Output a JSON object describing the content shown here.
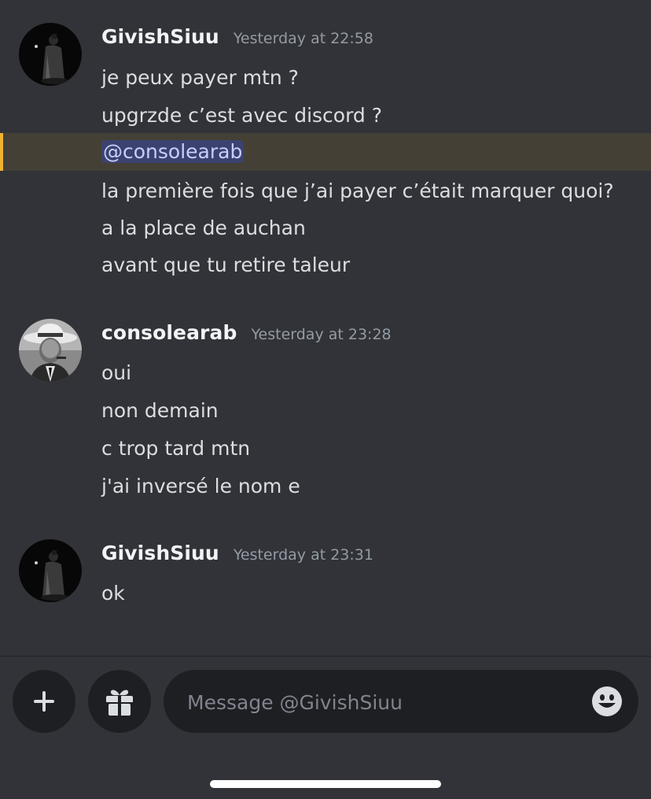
{
  "conversation": {
    "groups": [
      {
        "username": "GivishSiuu",
        "timestamp": "Yesterday at 22:58",
        "avatar": "dark-night-figure-avatar",
        "lines": [
          "je peux payer mtn ?",
          "upgrzde c’est avec discord ?",
          "@consolearab",
          "la première fois que j’ai payer c’était marquer quoi?",
          "a la place de auchan",
          "avant que tu retire taleur"
        ]
      },
      {
        "username": "consolearab",
        "timestamp": "Yesterday at 23:28",
        "avatar": "man-in-fedora-avatar",
        "lines": [
          "oui",
          "non demain",
          "c trop tard mtn",
          "j'ai inversé le nom e"
        ]
      },
      {
        "username": "GivishSiuu",
        "timestamp": "Yesterday at 23:31",
        "avatar": "dark-night-figure-avatar",
        "lines": [
          "ok"
        ]
      }
    ]
  },
  "composer": {
    "add_icon": "plus-icon",
    "gift_icon": "gift-icon",
    "placeholder": "Message @GivishSiuu",
    "emoji_icon": "emoji-smile-icon"
  },
  "colors": {
    "background": "#313338",
    "mention_highlight": "#444036",
    "mention_bar": "#f0b232",
    "mention_pill": "#3c4270",
    "mention_text": "#c9cdfb",
    "input_bg": "#1e1f22"
  }
}
